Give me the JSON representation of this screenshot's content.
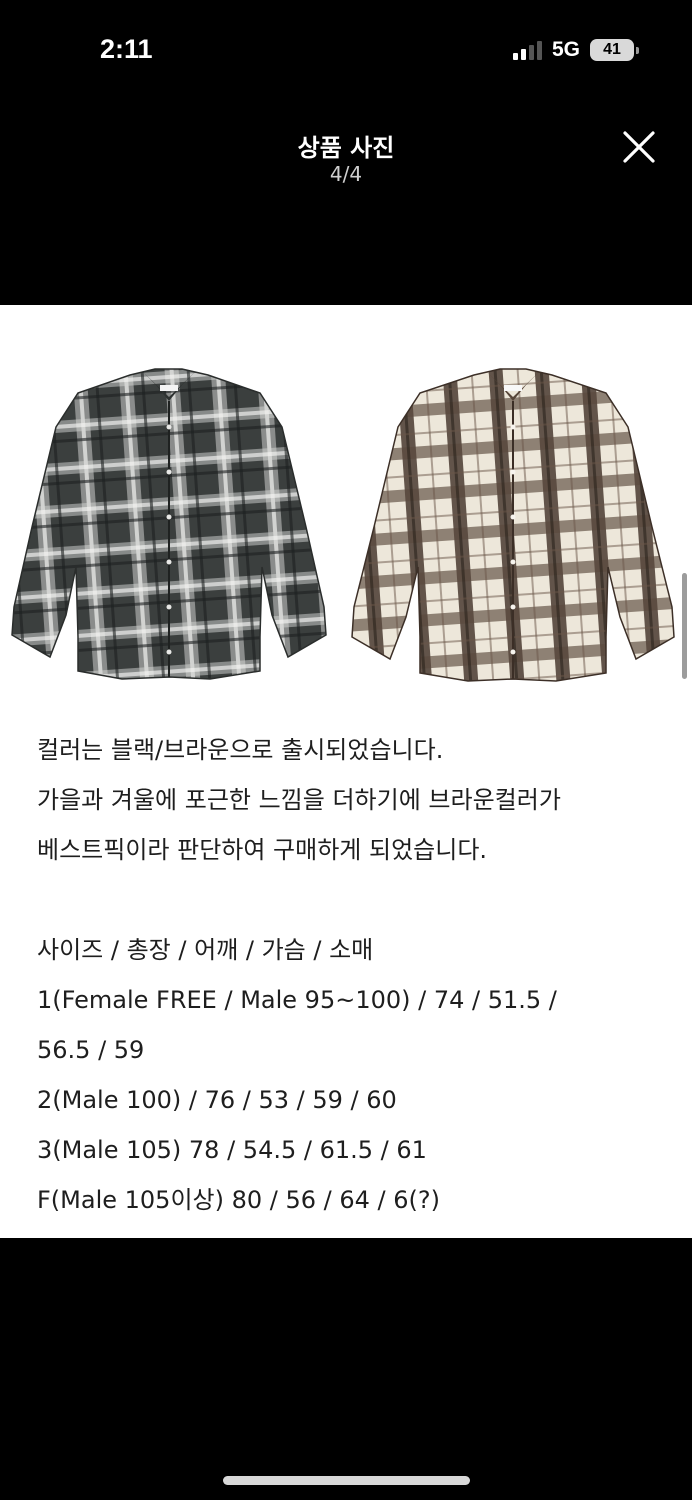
{
  "status_bar": {
    "time": "2:11",
    "network": "5G",
    "battery": "41"
  },
  "header": {
    "title": "상품 사진",
    "counter": "4/4"
  },
  "product_images": [
    {
      "name": "black-check-shirt",
      "colorway": "black"
    },
    {
      "name": "brown-check-shirt",
      "colorway": "brown"
    }
  ],
  "description": {
    "intro": [
      "컬러는 블랙/브라운으로 출시되었습니다.",
      "가을과 겨울에 포근한 느낌을 더하기에 브라운컬러가",
      "베스트픽이라 판단하여 구매하게 되었습니다."
    ],
    "size_header": "사이즈 / 총장 / 어깨 / 가슴 / 소매",
    "sizes": [
      "1(Female FREE / Male 95~100) / 74 / 51.5 /",
      "56.5 / 59",
      "2(Male 100) / 76 / 53 / 59 / 60",
      "3(Male 105) 78 / 54.5 / 61.5 / 61",
      "F(Male 105이상) 80 / 56 / 64 / 6(?)"
    ]
  },
  "colors": {
    "background": "#000000",
    "panel": "#ffffff",
    "text": "#1e1e1e",
    "black_shirt_base": "#3a3f3d",
    "brown_shirt_base": "#e9e3d6",
    "brown_check": "#4a3a2f"
  },
  "icons": {
    "close": "close-icon",
    "signal": "signal-icon",
    "battery": "battery-icon"
  }
}
